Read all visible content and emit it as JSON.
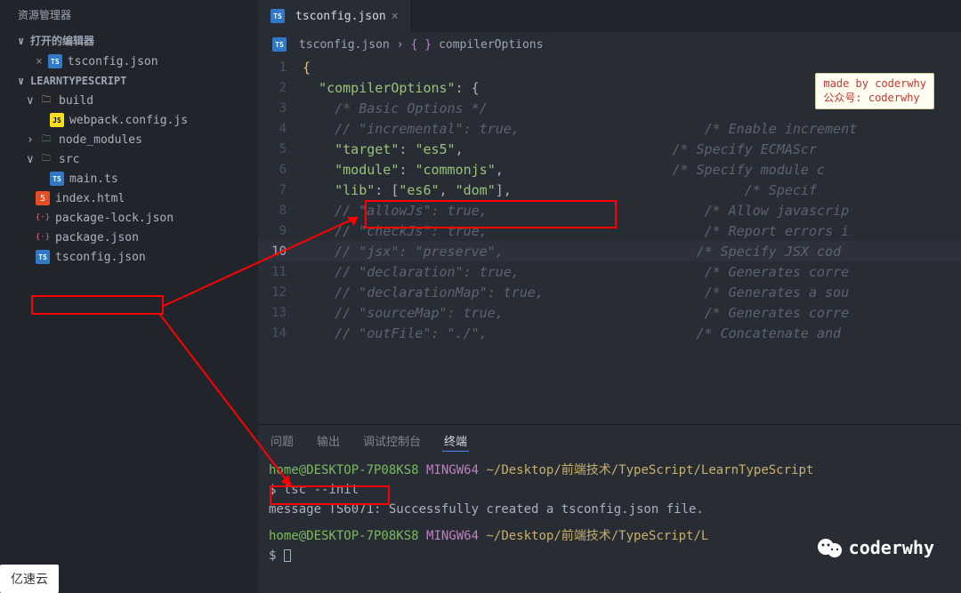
{
  "sidebar": {
    "title": "资源管理器",
    "openEditors": "打开的编辑器",
    "openFile": "tsconfig.json",
    "project": "LEARNTYPESCRIPT",
    "tree": {
      "build": "build",
      "webpack": "webpack.config.js",
      "node_modules": "node_modules",
      "src": "src",
      "main": "main.ts",
      "index": "index.html",
      "pkglock": "package-lock.json",
      "pkg": "package.json",
      "tsconfig": "tsconfig.json"
    }
  },
  "tab": {
    "file": "tsconfig.json",
    "close": "×"
  },
  "breadcrumb": {
    "a": "tsconfig.json",
    "sep": "›",
    "b": "{ }",
    "c": "compilerOptions"
  },
  "code": {
    "l1": "{",
    "l2a": "\"compilerOptions\"",
    "l2b": ": {",
    "l3": "/* Basic Options */",
    "l4a": "// \"incremental\": true,",
    "l4b": "/* Enable increment",
    "l5a": "\"target\"",
    "l5b": ": ",
    "l5c": "\"es5\"",
    "l5d": ",",
    "l5e": "/* Specify ECMAScr",
    "l6a": "\"module\"",
    "l6b": ": ",
    "l6c": "\"commonjs\"",
    "l6d": ",",
    "l6e": "/* Specify module c",
    "l7a": "\"lib\"",
    "l7b": ": [",
    "l7c": "\"es6\"",
    "l7d": ", ",
    "l7e": "\"dom\"",
    "l7f": "],",
    "l7g": "/* Specif",
    "l8a": "// \"allowJs\": true,",
    "l8b": "/* Allow javascrip",
    "l9a": "// \"checkJs\": true,",
    "l9b": "/* Report errors i",
    "l10a": "// \"jsx\": \"preserve\",",
    "l10b": "/* Specify JSX cod",
    "l11a": "// \"declaration\": true,",
    "l11b": "/* Generates corre",
    "l12a": "// \"declarationMap\": true,",
    "l12b": "/* Generates a sou",
    "l13a": "// \"sourceMap\": true,",
    "l13b": "/* Generates corre",
    "l14a": "// \"outFile\": \"./\",",
    "l14b": "/* Concatenate and "
  },
  "note": {
    "l1": "made by coderwhy",
    "l2": "公众号: coderwhy"
  },
  "terminalTabs": {
    "a": "问题",
    "b": "输出",
    "c": "调试控制台",
    "d": "终端"
  },
  "terminal": {
    "p1a": "home@DESKTOP-7P08KS8",
    "p1b": "MINGW64",
    "p1c": "~/Desktop/前端技术/TypeScript/LearnTypeScript",
    "cmd1": "$ tsc --init",
    "msg": "message TS6071: Successfully created a tsconfig.json file.",
    "p2c": "~/Desktop/前端技术/TypeScript/L",
    "prompt": "$ "
  },
  "watermark": "coderwhy",
  "bottomBar": "亿速云"
}
